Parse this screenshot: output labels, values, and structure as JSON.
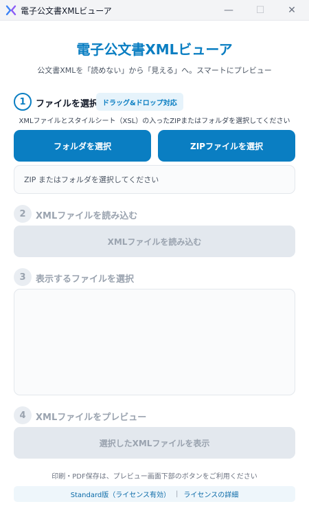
{
  "window": {
    "title": "電子公文書XMLビューア",
    "minimize_glyph": "—",
    "maximize_glyph": "☐",
    "close_glyph": "✕"
  },
  "header": {
    "title": "電子公文書XMLビューア",
    "subtitle": "公文書XMLを「読めない」から「見える」へ。スマートにプレビュー"
  },
  "step1": {
    "number": "1",
    "title": "ファイルを選択",
    "badge": "ドラッグ&ドロップ対応",
    "hint": "XMLファイルとスタイルシート（XSL）の入ったZIPまたはフォルダを選択してください",
    "folder_button": "フォルダを選択",
    "zip_button": "ZIPファイルを選択",
    "path_placeholder": "ZIP またはフォルダを選択してください"
  },
  "step2": {
    "number": "2",
    "title": "XMLファイルを読み込む",
    "button": "XMLファイルを読み込む"
  },
  "step3": {
    "number": "3",
    "title": "表示するファイルを選択"
  },
  "step4": {
    "number": "4",
    "title": "XMLファイルをプレビュー",
    "button": "選択したXMLファイルを表示"
  },
  "footer": {
    "note": "印刷・PDF保存は、プレビュー画面下部のボタンをご利用ください",
    "license_status": "Standard版（ライセンス有効）",
    "separator": "|",
    "license_link": "ライセンスの詳細"
  },
  "colors": {
    "accent": "#0a7ec2",
    "disabled_bg": "#e3e8ee",
    "disabled_text": "#9aa3af"
  }
}
